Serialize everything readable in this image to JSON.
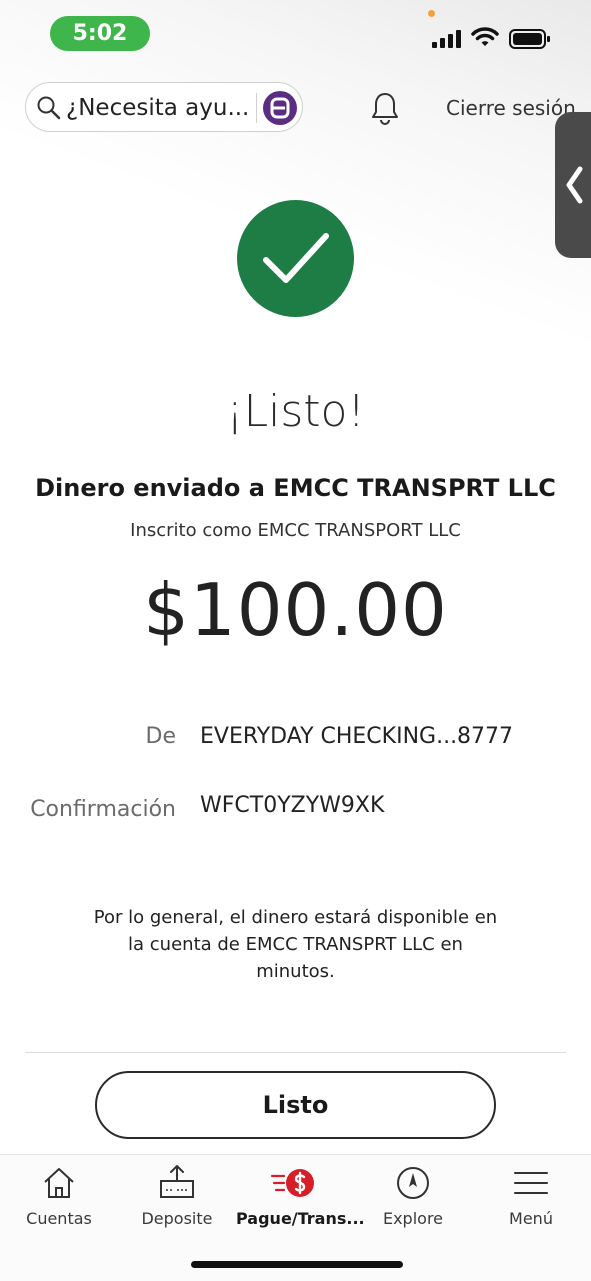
{
  "status_bar": {
    "time": "5:02"
  },
  "header": {
    "search_placeholder": "¿Necesita ayu...",
    "logout_label": "Cierre sesión"
  },
  "confirmation": {
    "title": "¡Listo!",
    "sent_to": "Dinero enviado a EMCC TRANSPRT LLC",
    "registered_as": "Inscrito como EMCC TRANSPORT LLC",
    "amount": "$100.00",
    "from_label": "De",
    "from_value": "EVERYDAY CHECKING...8777",
    "confirmation_label": "Confirmación",
    "confirmation_value": "WFCT0YZYW9XK",
    "note": "Por lo general, el dinero estará disponible en la cuenta de EMCC TRANSPRT LLC en minutos.",
    "done_button": "Listo"
  },
  "tabbar": {
    "items": [
      {
        "label": "Cuentas",
        "icon": "home-icon"
      },
      {
        "label": "Deposite",
        "icon": "deposit-icon"
      },
      {
        "label": "Pague/Trans...",
        "icon": "pay-transfer-icon",
        "active": true
      },
      {
        "label": "Explore",
        "icon": "compass-icon"
      },
      {
        "label": "Menú",
        "icon": "hamburger-icon"
      }
    ]
  },
  "colors": {
    "success_green": "#1e7d45",
    "status_time_green": "#3fb64b",
    "active_tab_red": "#d71e28",
    "fargo_purple": "#5b2d82"
  }
}
